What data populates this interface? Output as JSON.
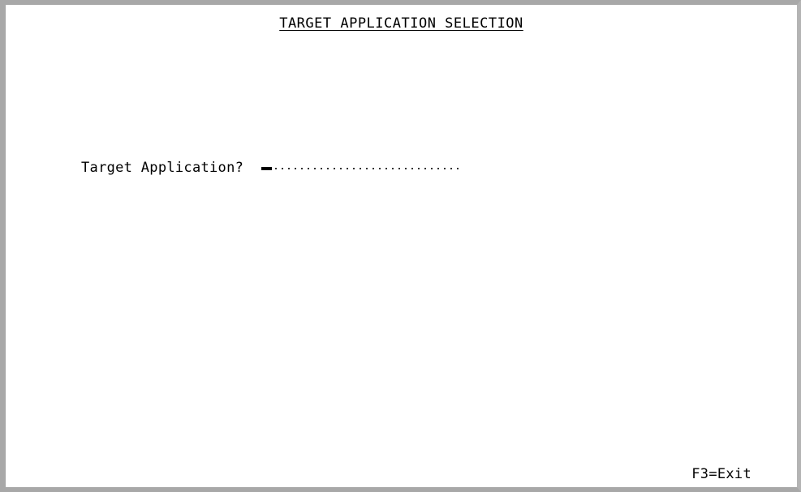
{
  "screen": {
    "title": "TARGET APPLICATION SELECTION"
  },
  "form": {
    "target_application": {
      "label": "Target Application?",
      "value": "",
      "field_length": 20
    }
  },
  "function_keys": {
    "exit": "F3=Exit"
  }
}
